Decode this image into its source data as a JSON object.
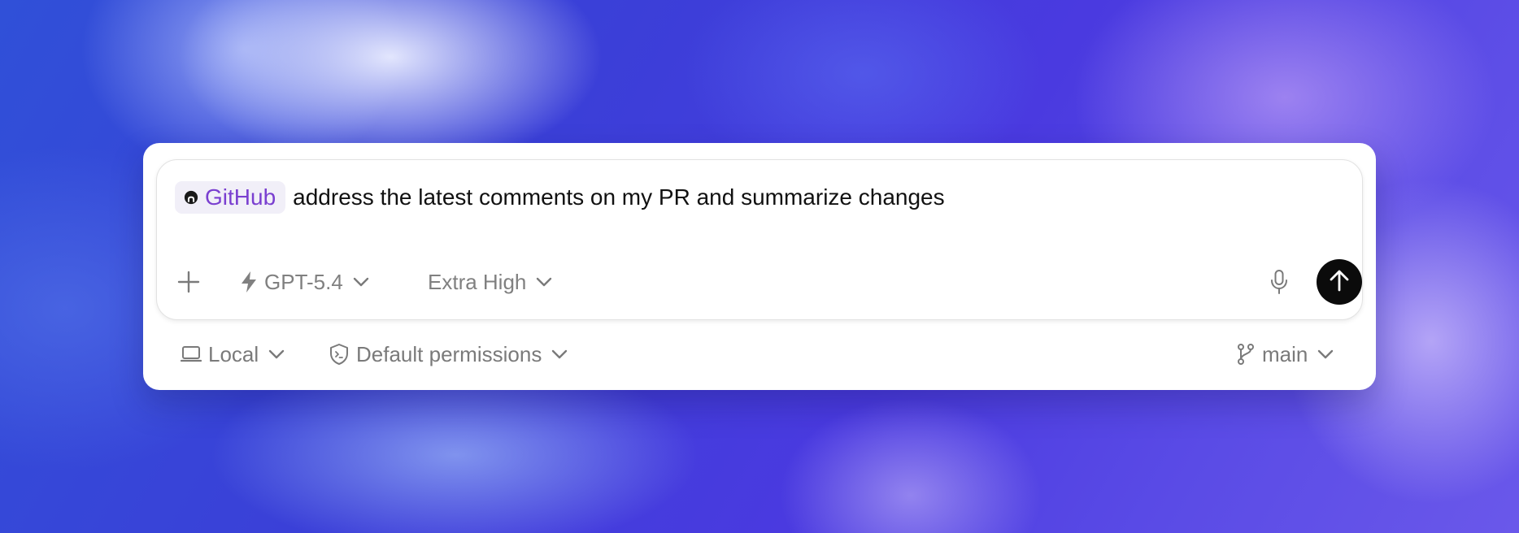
{
  "composer": {
    "mention_chip": {
      "label": "GitHub",
      "icon": "github-icon",
      "color": "#7a3fd0"
    },
    "prompt_text": "address the latest comments on my PR and summarize changes",
    "toolbar": {
      "add_icon": "plus-icon",
      "model": {
        "icon": "lightning-icon",
        "label": "GPT-5.4"
      },
      "reasoning": {
        "label": "Extra High"
      },
      "mic_icon": "microphone-icon",
      "send_icon": "arrow-up-icon"
    }
  },
  "footer": {
    "environment": {
      "icon": "laptop-icon",
      "label": "Local"
    },
    "permissions": {
      "icon": "shield-terminal-icon",
      "label": "Default permissions"
    },
    "branch": {
      "icon": "git-branch-icon",
      "label": "main"
    }
  }
}
